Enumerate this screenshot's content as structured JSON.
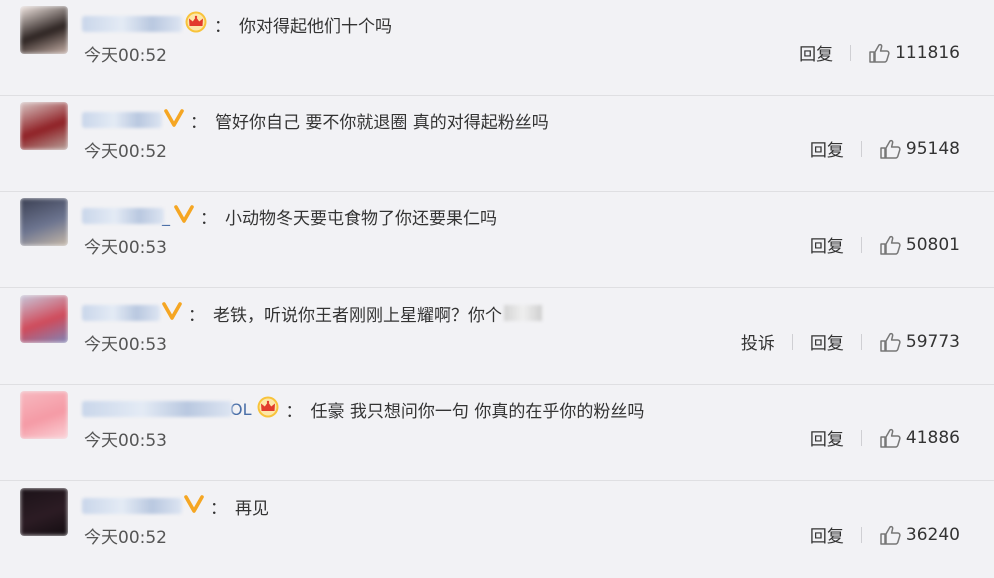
{
  "comments": [
    {
      "username_tail": "",
      "badge": "crown",
      "text": "你对得起他们十个吗",
      "time": "今天00:52",
      "report": "",
      "reply": "回复",
      "likes": "111816",
      "avatar_colors": [
        "#f4e9e4",
        "#2b2220",
        "#c9b3aa"
      ],
      "name_w": 100
    },
    {
      "username_tail": "",
      "badge": "v",
      "text": "管好你自己 要不你就退圈 真的对得起粉丝吗",
      "time": "今天00:52",
      "report": "",
      "reply": "回复",
      "likes": "95148",
      "avatar_colors": [
        "#d9c8c6",
        "#8f1f24",
        "#b7a39c"
      ],
      "name_w": 80
    },
    {
      "username_tail": "_",
      "badge": "v",
      "text": "小动物冬天要屯食物了你还要果仁吗",
      "time": "今天00:53",
      "report": "",
      "reply": "回复",
      "likes": "50801",
      "avatar_colors": [
        "#3a3f52",
        "#6d7590",
        "#c7b9a8"
      ],
      "name_w": 82
    },
    {
      "username_tail": "",
      "badge": "v",
      "text": "老铁，听说你王者刚刚上星耀啊？你个",
      "time": "今天00:53",
      "report": "投诉",
      "reply": "回复",
      "likes": "59773",
      "avatar_colors": [
        "#c7c9dc",
        "#d04a5a",
        "#7e86b8"
      ],
      "name_w": 78
    },
    {
      "username_tail": "OL",
      "badge": "crown",
      "text": "任豪 我只想问你一句 你真的在乎你的粉丝吗",
      "time": "今天00:53",
      "report": "",
      "reply": "回复",
      "likes": "41886",
      "avatar_colors": [
        "#f7b9c0",
        "#f59aa5",
        "#fbd3d8"
      ],
      "name_w": 150
    },
    {
      "username_tail": "",
      "badge": "v",
      "text": "再见",
      "time": "今天00:52",
      "report": "",
      "reply": "回复",
      "likes": "36240",
      "avatar_colors": [
        "#1b1218",
        "#2c1c24",
        "#120c10"
      ],
      "name_w": 100
    }
  ],
  "icons": {
    "like": "thumbs-up-icon",
    "v_badge": "verified-v-icon",
    "crown_badge": "crown-icon"
  },
  "colors": {
    "v_badge": "#f5a623",
    "crown": "#f6b500",
    "accent": "#4a6fa8"
  }
}
